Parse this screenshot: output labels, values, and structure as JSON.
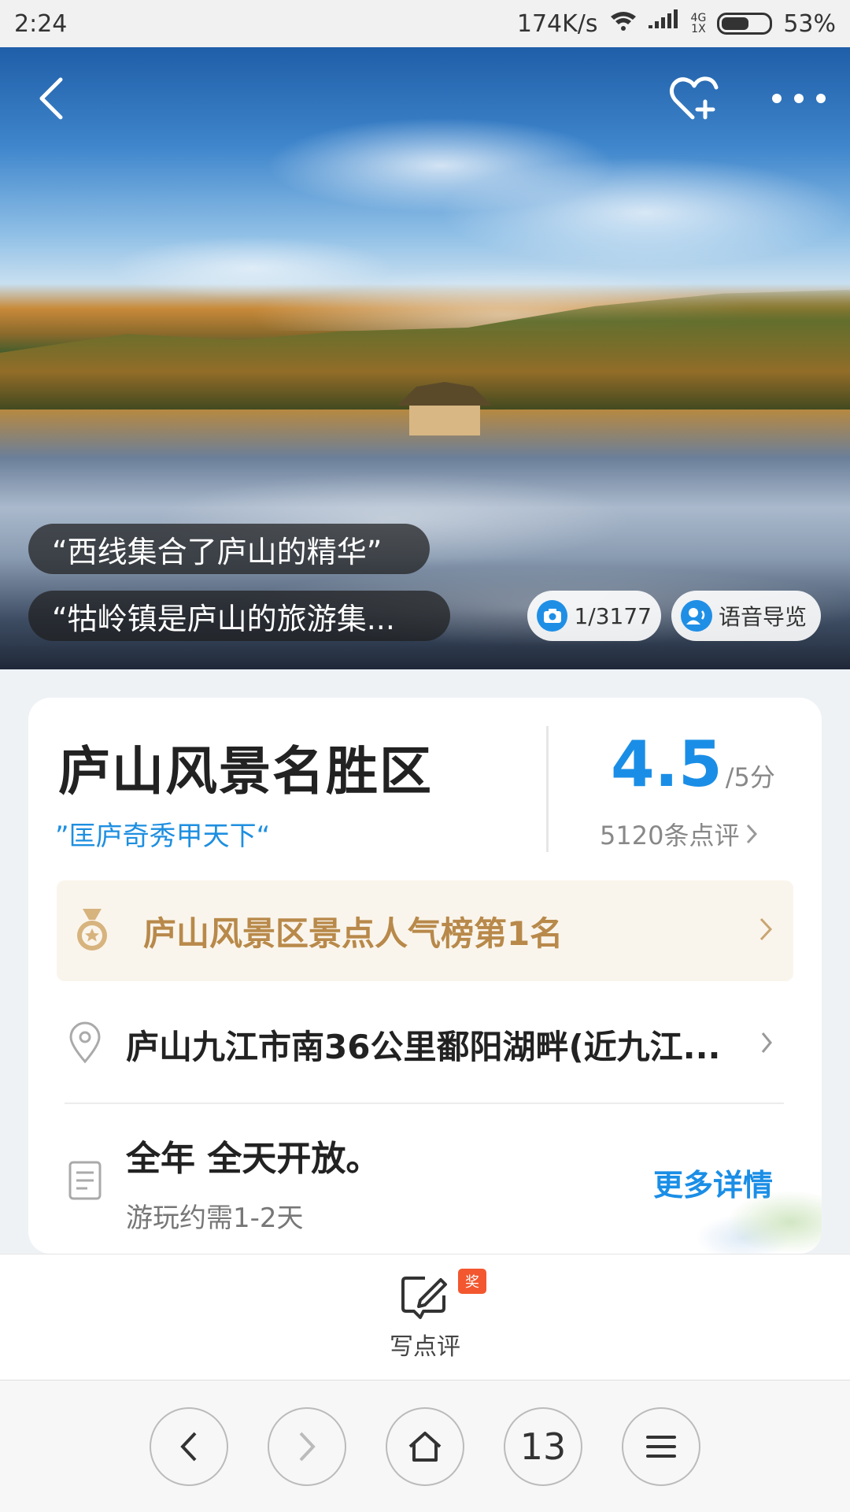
{
  "status_bar": {
    "time": "2:24",
    "speed": "174K/s",
    "net_top": "4G",
    "net_bottom": "1X",
    "battery": "53%"
  },
  "hero": {
    "quotes": [
      "“西线集合了庐山的精华”",
      "“牯岭镇是庐山的旅游集..."
    ],
    "photo_counter": "1/3177",
    "voice_guide": "语音导览"
  },
  "attraction": {
    "name": "庐山风景名胜区",
    "slogan": "”匡庐奇秀甲天下“",
    "rating": "4.5",
    "rating_max": "/5分",
    "reviews": "5120条点评",
    "rank": "庐山风景区景点人气榜第1名",
    "address": "庐山九江市南36公里鄱阳湖畔(近九江...",
    "hours": "全年 全天开放。",
    "duration": "游玩约需1-2天",
    "more_details": "更多详情"
  },
  "write_review": {
    "label": "写点评",
    "badge": "奖"
  },
  "browser_nav": {
    "tabs_count": "13"
  },
  "colors": {
    "accent": "#1a8ee6",
    "gold": "#b8894a",
    "badge": "#f2572f"
  }
}
